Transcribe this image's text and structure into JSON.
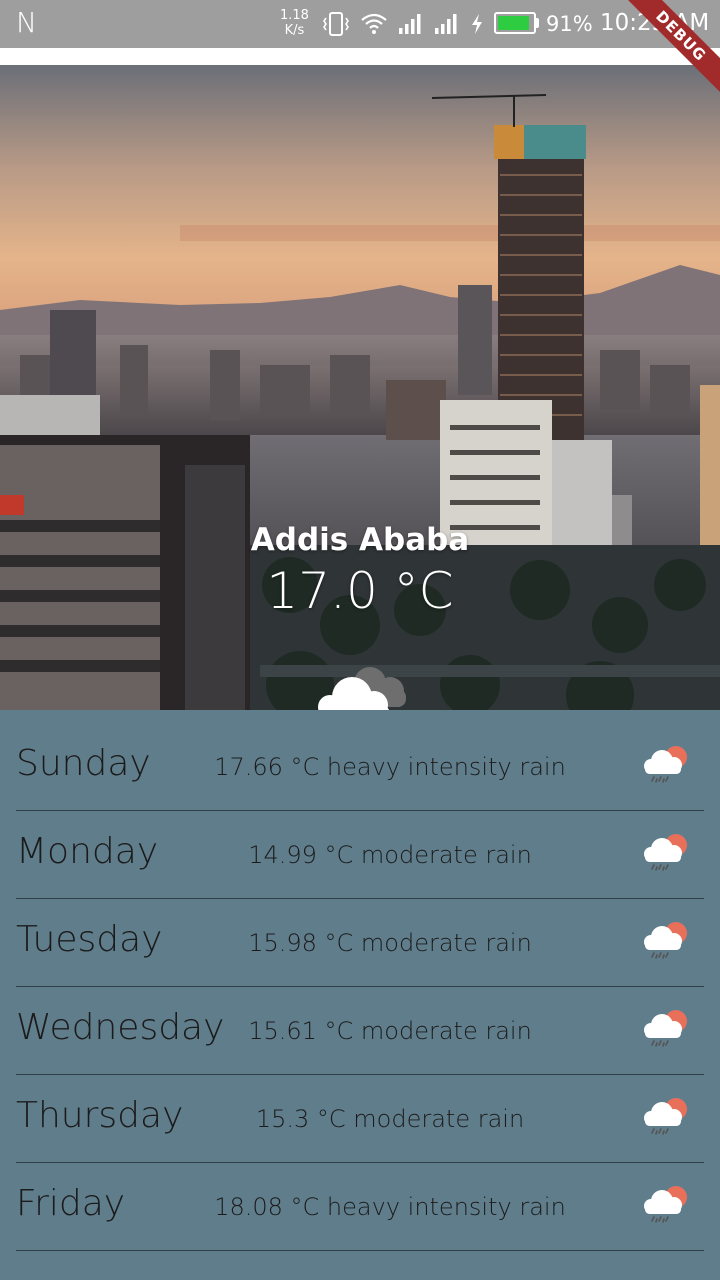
{
  "status_bar": {
    "left_letter": "N",
    "net_speed_value": "1.18",
    "net_speed_unit": "K/s",
    "battery_percent_text": "91%",
    "battery_level": 0.91,
    "time": "10:25 AM",
    "icons": [
      "vibrate-icon",
      "wifi-icon",
      "signal-icon",
      "signal-icon",
      "charging-icon",
      "battery-icon"
    ],
    "battery_color": "#2ecc40"
  },
  "debug_banner": "DEBUG",
  "current": {
    "city": "Addis Ababa",
    "temperature": "17.0 °C",
    "icon": "cloud-icon"
  },
  "forecast": [
    {
      "day": "Sunday",
      "summary": "17.66 °C heavy intensity rain",
      "icon": "sun-cloud-rain-icon"
    },
    {
      "day": "Monday",
      "summary": "14.99 °C moderate rain",
      "icon": "sun-cloud-rain-icon"
    },
    {
      "day": "Tuesday",
      "summary": "15.98 °C moderate rain",
      "icon": "sun-cloud-rain-icon"
    },
    {
      "day": "Wednesday",
      "summary": "15.61 °C moderate rain",
      "icon": "sun-cloud-rain-icon"
    },
    {
      "day": "Thursday",
      "summary": "15.3 °C moderate rain",
      "icon": "sun-cloud-rain-icon"
    },
    {
      "day": "Friday",
      "summary": "18.08 °C heavy intensity rain",
      "icon": "sun-cloud-rain-icon"
    }
  ],
  "colors": {
    "list_background": "#607d8b",
    "divider": "#2f3f47",
    "status_bar": "#9e9e9e",
    "debug_banner": "#a12a2a"
  }
}
